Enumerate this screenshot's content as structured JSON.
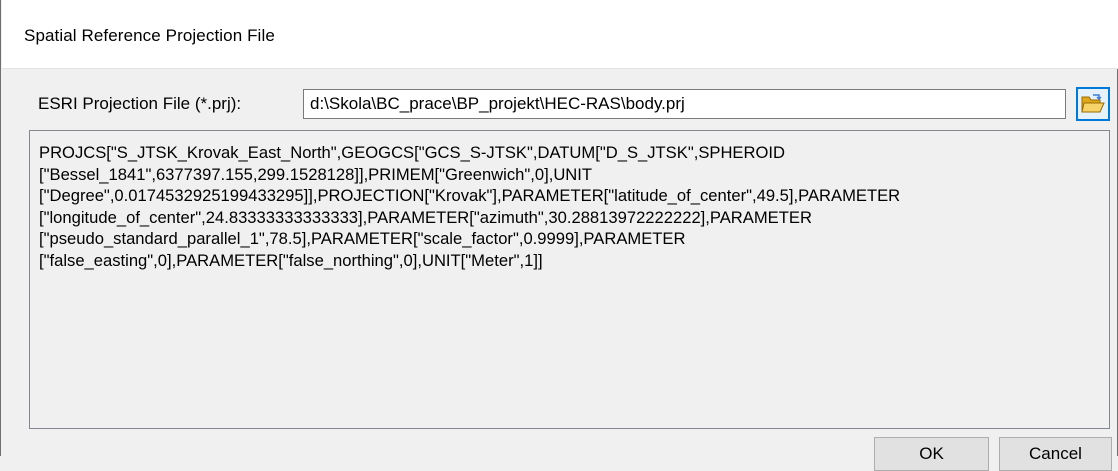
{
  "window": {
    "title": "Spatial Reference Projection File"
  },
  "projection_file": {
    "label": "ESRI Projection File (*.prj):",
    "value": "d:\\Skola\\BC_prace\\BP_projekt\\HEC-RAS\\body.prj",
    "browse_icon": "open-folder-icon"
  },
  "projection_text": "PROJCS[\"S_JTSK_Krovak_East_North\",GEOGCS[\"GCS_S-JTSK\",DATUM[\"D_S_JTSK\",SPHEROID\n[\"Bessel_1841\",6377397.155,299.1528128]],PRIMEM[\"Greenwich\",0],UNIT\n[\"Degree\",0.0174532925199433295]],PROJECTION[\"Krovak\"],PARAMETER[\"latitude_of_center\",49.5],PARAMETER\n[\"longitude_of_center\",24.83333333333333],PARAMETER[\"azimuth\",30.28813972222222],PARAMETER\n[\"pseudo_standard_parallel_1\",78.5],PARAMETER[\"scale_factor\",0.9999],PARAMETER\n[\"false_easting\",0],PARAMETER[\"false_northing\",0],UNIT[\"Meter\",1]]",
  "buttons": {
    "ok": "OK",
    "cancel": "Cancel"
  },
  "colors": {
    "window_bg": "#f0f0f0",
    "titlebar_bg": "#ffffff",
    "accent": "#0078d7",
    "folder_yellow": "#f5c342"
  }
}
